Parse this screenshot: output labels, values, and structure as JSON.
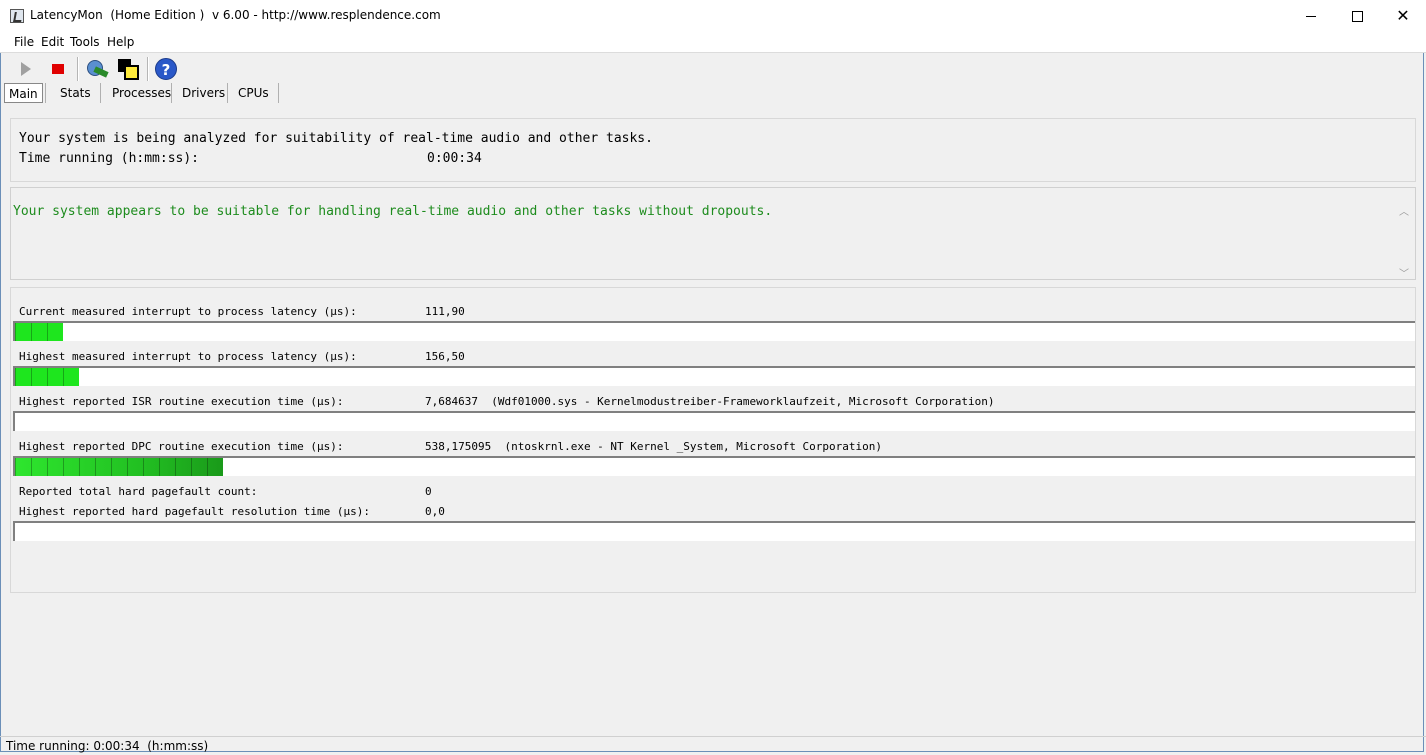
{
  "window": {
    "title": "LatencyMon  (Home Edition )  v 6.00 - http://www.resplendence.com"
  },
  "menu": [
    "File",
    "Edit",
    "Tools",
    "Help"
  ],
  "toolbar": {
    "icons": [
      "play-icon",
      "stop-icon",
      "tool-icon",
      "window-icon",
      "help-icon"
    ]
  },
  "tabs": [
    "Main",
    "Stats",
    "Processes",
    "Drivers",
    "CPUs"
  ],
  "status_panel": {
    "line1": "Your system is being analyzed for suitability of real-time audio and other tasks.",
    "time_label": "Time running (h:mm:ss):",
    "time_value": "0:00:34"
  },
  "verdict": {
    "text": "Your system appears to be suitable for handling real-time audio and other tasks without dropouts.",
    "color": "#1e8c1e"
  },
  "metrics": [
    {
      "label": "Current measured interrupt to process latency (µs):",
      "value": "111,90",
      "level": 0.033
    },
    {
      "label": "Highest measured interrupt to process latency (µs):",
      "value": "156,50",
      "level": 0.044
    },
    {
      "label": "Highest reported ISR routine execution time (µs):",
      "value": "7,684637  (Wdf01000.sys - Kernelmodustreiber-Frameworklaufzeit, Microsoft Corporation)",
      "level": 0
    },
    {
      "label": "Highest reported DPC routine execution time (µs):",
      "value": "538,175095  (ntoskrnl.exe - NT Kernel _System, Microsoft Corporation)",
      "level": 0.147
    },
    {
      "label": "Reported total hard pagefault count:",
      "value": "0"
    },
    {
      "label": "Highest reported hard pagefault resolution time (µs):",
      "value": "0,0",
      "level": 0
    }
  ],
  "statusbar": {
    "text": "Time running: 0:00:34  (h:mm:ss)"
  }
}
